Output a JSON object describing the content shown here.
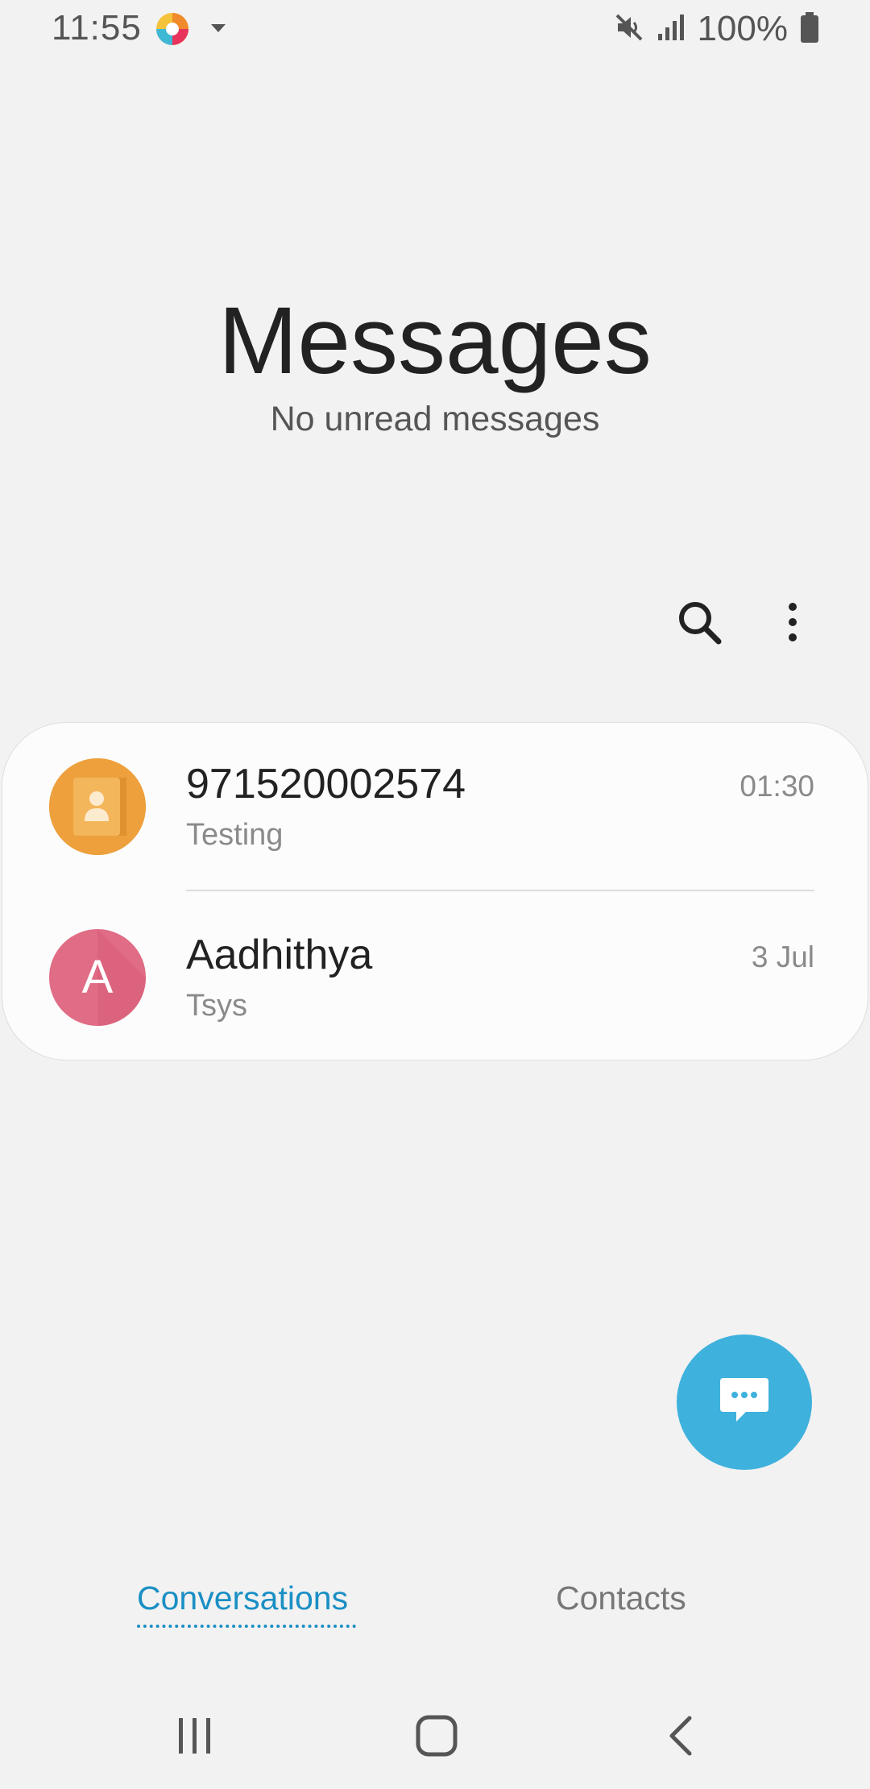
{
  "status_bar": {
    "time": "11:55",
    "battery": "100%",
    "icons": [
      "app-icon",
      "dropdown-icon",
      "mute-icon",
      "signal-icon",
      "battery-icon"
    ]
  },
  "header": {
    "title": "Messages",
    "subtitle": "No unread messages"
  },
  "toolbar": {
    "icons": [
      "search-icon",
      "more-options-icon"
    ]
  },
  "conversations": [
    {
      "name": "971520002574",
      "snippet": "Testing",
      "time": "01:30",
      "avatar": "contact-icon",
      "avatar_color": "#eda03c"
    },
    {
      "name": "Aadhithya",
      "snippet": "Tsys",
      "time": "3 Jul",
      "avatar_letter": "A",
      "avatar_color": "#e06c85"
    }
  ],
  "fab": {
    "icon": "new-message-icon",
    "color": "#3fb1dd"
  },
  "tabs": [
    {
      "label": "Conversations",
      "active": true
    },
    {
      "label": "Contacts",
      "active": false
    }
  ],
  "accent_color": "#1a8fc4",
  "nav_bar": {
    "icons": [
      "recent-apps-icon",
      "home-icon",
      "back-icon"
    ]
  }
}
